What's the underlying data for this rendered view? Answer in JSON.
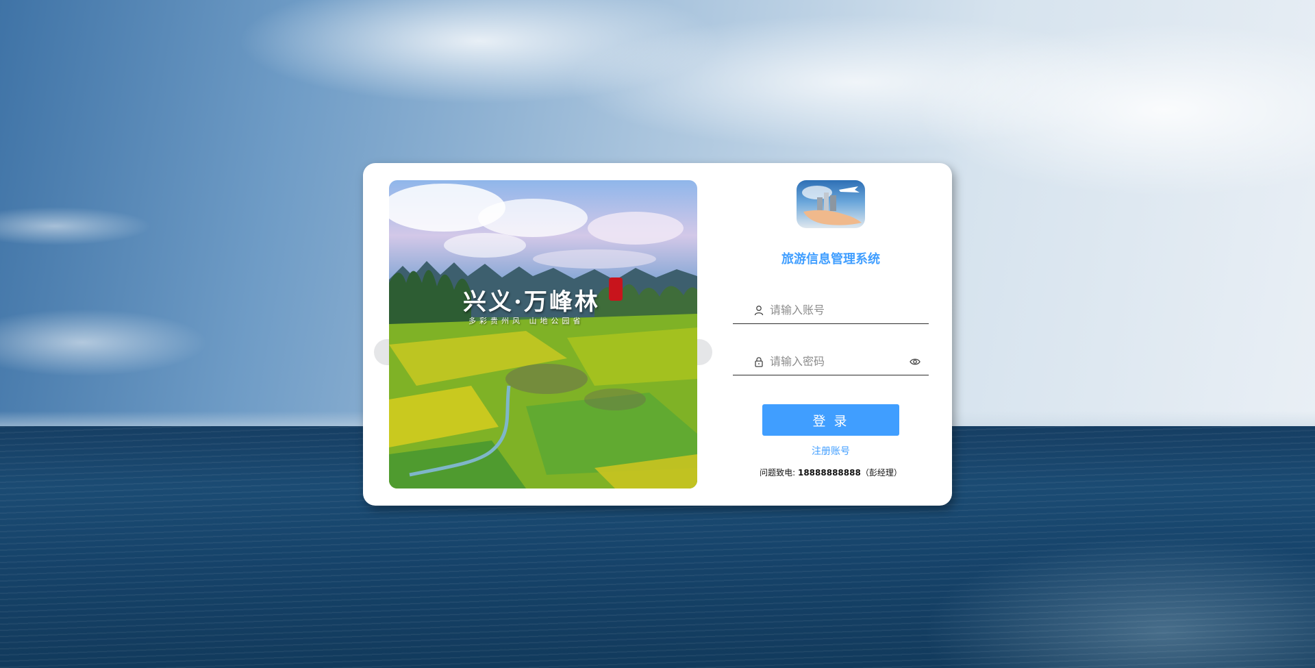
{
  "carousel": {
    "title": "兴义·万峰林",
    "subtitle": "多彩贵州风 山地公园省"
  },
  "header": {
    "system_title": "旅游信息管理系统"
  },
  "form": {
    "username_placeholder": "请输入账号",
    "password_placeholder": "请输入密码",
    "login_label": "登 录",
    "register_label": "注册账号"
  },
  "contact": {
    "prefix": "问题致电: ",
    "phone": "18888888888",
    "suffix": "（彭经理）"
  },
  "colors": {
    "accent": "#409eff",
    "card": "#ffffff"
  },
  "icons": {
    "user": "user-icon",
    "lock": "lock-icon",
    "eye": "eye-icon"
  }
}
